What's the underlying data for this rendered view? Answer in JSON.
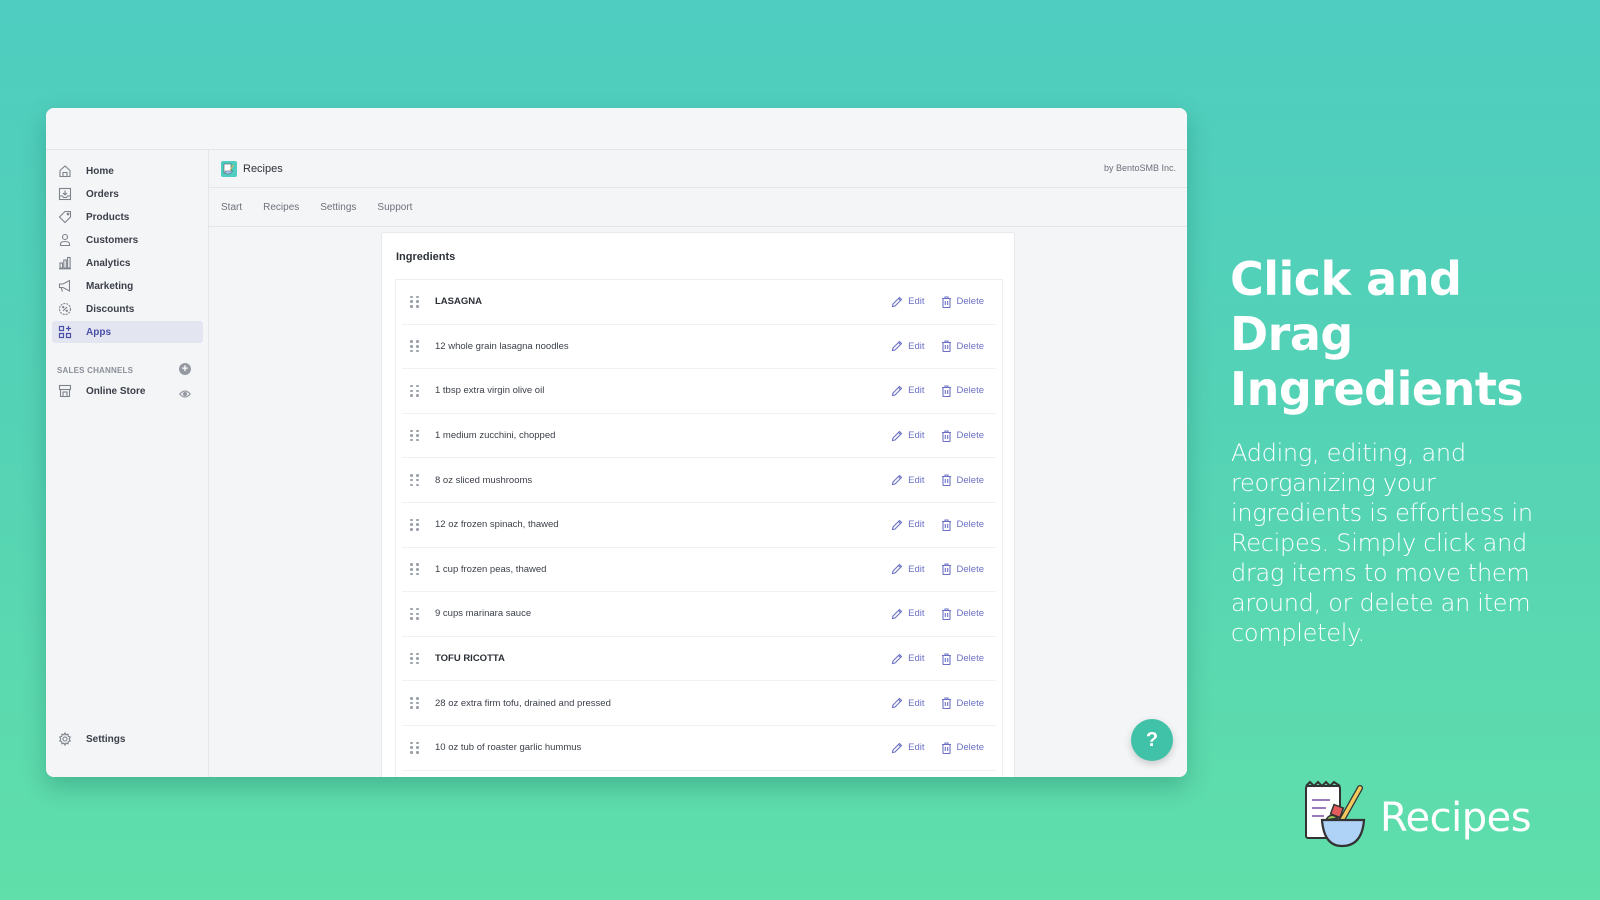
{
  "app": {
    "title": "Recipes",
    "vendor": "by BentoSMB Inc."
  },
  "sidebar": {
    "items": [
      {
        "label": "Home",
        "icon": "home-icon"
      },
      {
        "label": "Orders",
        "icon": "orders-icon"
      },
      {
        "label": "Products",
        "icon": "tag-icon"
      },
      {
        "label": "Customers",
        "icon": "person-icon"
      },
      {
        "label": "Analytics",
        "icon": "bar-chart-icon"
      },
      {
        "label": "Marketing",
        "icon": "megaphone-icon"
      },
      {
        "label": "Discounts",
        "icon": "discount-icon"
      },
      {
        "label": "Apps",
        "icon": "apps-icon",
        "active": true
      }
    ],
    "sales_channels_title": "SALES CHANNELS",
    "channels": [
      {
        "label": "Online Store",
        "icon": "store-icon"
      }
    ],
    "settings_label": "Settings"
  },
  "tabs": [
    {
      "label": "Start"
    },
    {
      "label": "Recipes"
    },
    {
      "label": "Settings"
    },
    {
      "label": "Support"
    }
  ],
  "ingredients": {
    "title": "Ingredients",
    "edit_label": "Edit",
    "delete_label": "Delete",
    "rows": [
      {
        "label": "LASAGNA",
        "heading": true
      },
      {
        "label": "12 whole grain lasagna noodles",
        "heading": false
      },
      {
        "label": "1 tbsp extra virgin olive oil",
        "heading": false
      },
      {
        "label": "1 medium zucchini, chopped",
        "heading": false
      },
      {
        "label": "8 oz sliced mushrooms",
        "heading": false
      },
      {
        "label": "12 oz frozen spinach, thawed",
        "heading": false
      },
      {
        "label": "1 cup frozen peas, thawed",
        "heading": false
      },
      {
        "label": "9 cups marinara sauce",
        "heading": false
      },
      {
        "label": "TOFU RICOTTA",
        "heading": true
      },
      {
        "label": "28 oz extra firm tofu, drained and pressed",
        "heading": false
      },
      {
        "label": "10 oz tub of roaster garlic hummus",
        "heading": false
      }
    ]
  },
  "help_button": "?",
  "promo": {
    "title": "Click and Drag Ingredients",
    "body": "Adding, editing, and reorganizing your ingredients is effortless in Recipes. Simply click and drag items to move them around, or delete an item completely."
  },
  "brand": {
    "name": "Recipes"
  },
  "colors": {
    "accent": "#6b70c4",
    "teal": "#4ecdc0",
    "green": "#60dfaa"
  }
}
